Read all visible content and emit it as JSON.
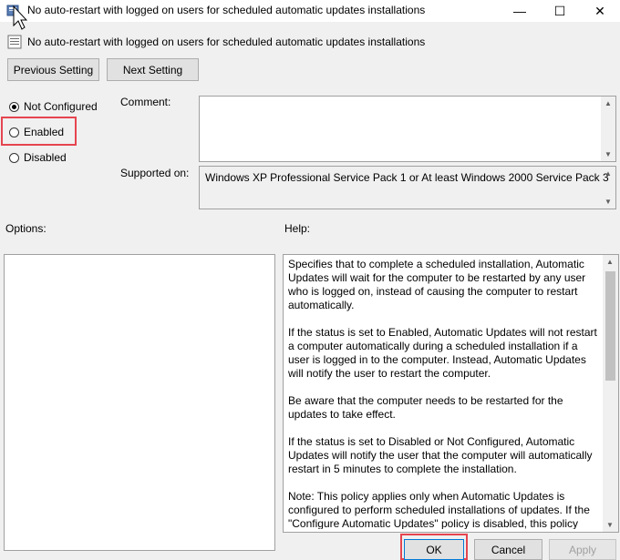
{
  "window": {
    "title": "No auto-restart with logged on users for scheduled automatic updates installations",
    "minimize_glyph": "—",
    "maximize_glyph": "☐",
    "close_glyph": "✕"
  },
  "policy": {
    "name": "No auto-restart with logged on users for scheduled automatic updates installations"
  },
  "nav": {
    "previous_label": "Previous Setting",
    "next_label": "Next Setting"
  },
  "state": {
    "options": [
      {
        "label": "Not Configured",
        "checked": true
      },
      {
        "label": "Enabled",
        "checked": false,
        "highlighted": true
      },
      {
        "label": "Disabled",
        "checked": false
      }
    ]
  },
  "comment": {
    "label": "Comment:",
    "value": ""
  },
  "supported": {
    "label": "Supported on:",
    "value": "Windows XP Professional Service Pack 1 or At least Windows 2000 Service Pack 3"
  },
  "options_section": {
    "label": "Options:"
  },
  "help": {
    "label": "Help:",
    "paragraphs": [
      "Specifies that to complete a scheduled installation, Automatic Updates will wait for the computer to be restarted by any user who is logged on, instead of causing the computer to restart automatically.",
      "If the status is set to Enabled, Automatic Updates will not restart a computer automatically during a scheduled installation if a user is logged in to the computer. Instead, Automatic Updates will notify the user to restart the computer.",
      "Be aware that the computer needs to be restarted for the updates to take effect.",
      "If the status is set to Disabled or Not Configured, Automatic Updates will notify the user that the computer will automatically restart in 5 minutes to complete the installation.",
      "Note: This policy applies only when Automatic Updates is configured to perform scheduled installations of updates. If the \"Configure Automatic Updates\" policy is disabled, this policy has"
    ]
  },
  "footer": {
    "ok_label": "OK",
    "cancel_label": "Cancel",
    "apply_label": "Apply"
  },
  "colors": {
    "highlight": "#e5454f",
    "accent_blue": "#0078d7"
  }
}
